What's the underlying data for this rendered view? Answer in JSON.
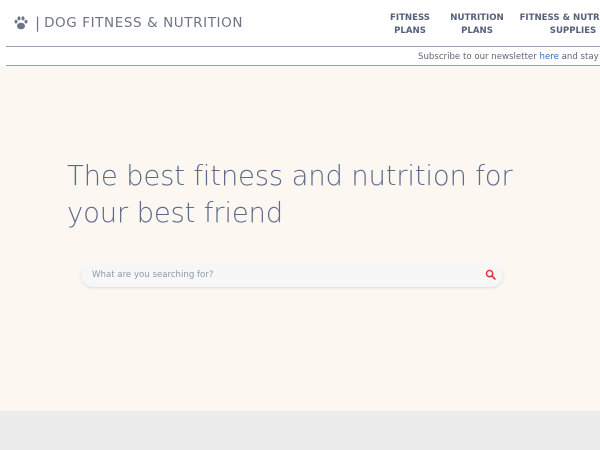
{
  "brand": {
    "separator": "|",
    "title": "DOG FITNESS & NUTRITION",
    "icon": "paw-icon"
  },
  "nav": {
    "items": [
      {
        "label": "FITNESS\nPLANS"
      },
      {
        "label": "NUTRITION\nPLANS"
      },
      {
        "label": "FITNESS & NUTRITION\nSUPPLIES"
      }
    ]
  },
  "newsletter": {
    "prefix": "Subscribe to our newsletter ",
    "link": "here",
    "suffix": " and stay up"
  },
  "hero": {
    "title": "The best fitness and nutrition for your best friend"
  },
  "search": {
    "placeholder": "What are you searching for?",
    "value": "",
    "icon": "search-icon",
    "icon_color": "#d63a3a"
  },
  "colors": {
    "background": "#fdf7f2",
    "header": "#ffffff",
    "footer": "#ececec",
    "link": "#2f6fbf",
    "title": "#5c6a8c"
  }
}
